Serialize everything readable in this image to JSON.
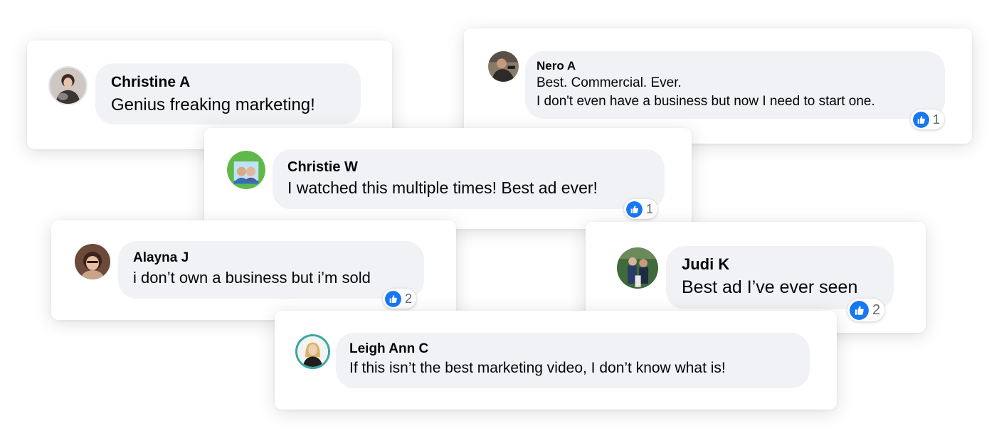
{
  "comments": [
    {
      "author": "Christine A",
      "lines": [
        "Genius freaking marketing!"
      ],
      "likes": ""
    },
    {
      "author": "Nero A",
      "lines": [
        "Best. Commercial. Ever.",
        "I don't even have a business but now I need to start one."
      ],
      "likes": "1"
    },
    {
      "author": "Christie W",
      "lines": [
        "I watched this multiple times! Best ad ever!"
      ],
      "likes": "1"
    },
    {
      "author": "Alayna J",
      "lines": [
        "i don’t own a business but i’m sold"
      ],
      "likes": "2"
    },
    {
      "author": "Judi K",
      "lines": [
        "Best ad I’ve ever seen"
      ],
      "likes": "2"
    },
    {
      "author": "Leigh Ann C",
      "lines": [
        "If this isn’t the best marketing video, I don’t know what is!"
      ],
      "likes": ""
    }
  ],
  "colors": {
    "bubble": "#f0f2f5",
    "like_blue": "#1877f2",
    "count_gray": "#65676b"
  },
  "icons": {
    "reaction": "thumbs-up-icon"
  }
}
